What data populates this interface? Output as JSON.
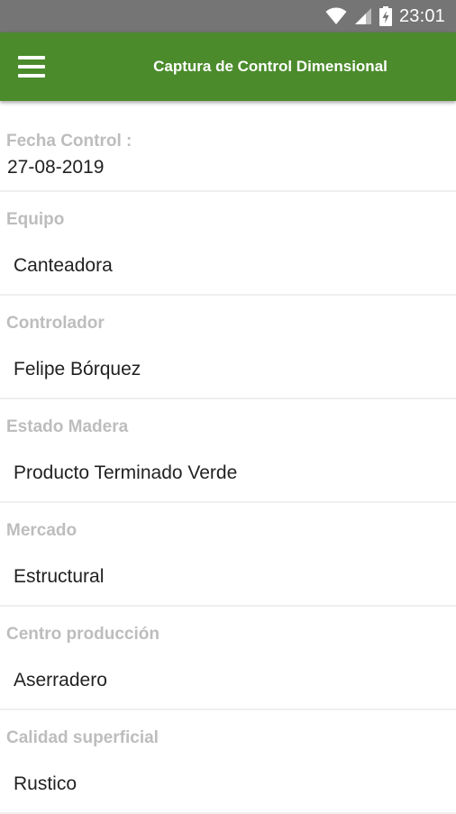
{
  "status_bar": {
    "time": "23:01",
    "icons": [
      "wifi-icon",
      "signal-icon",
      "battery-charging-icon"
    ]
  },
  "app_bar": {
    "title": "Captura de Control Dimensional",
    "menu_icon": "hamburger-menu-icon",
    "color": "#4b8b2c"
  },
  "form": {
    "fecha": {
      "label": "Fecha Control :",
      "value": "27-08-2019"
    },
    "fields": [
      {
        "label": "Equipo",
        "value": "Canteadora"
      },
      {
        "label": "Controlador",
        "value": "Felipe Bórquez"
      },
      {
        "label": "Estado Madera",
        "value": "Producto Terminado Verde"
      },
      {
        "label": "Mercado",
        "value": "Estructural"
      },
      {
        "label": "Centro producción",
        "value": "Aserradero"
      },
      {
        "label": "Calidad superficial",
        "value": "Rustico"
      }
    ]
  }
}
